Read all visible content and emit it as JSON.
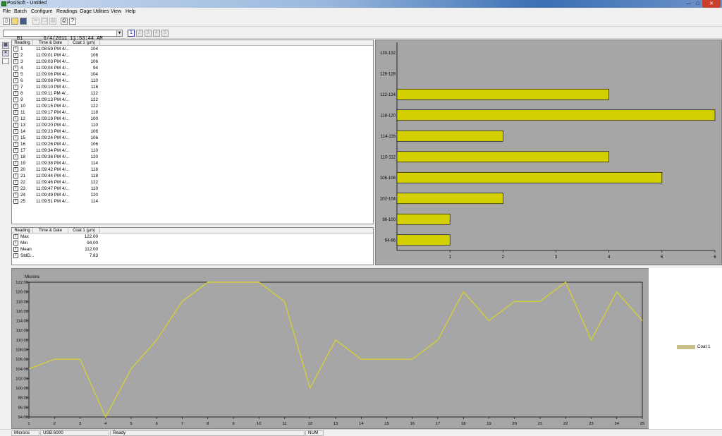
{
  "window": {
    "title": "PosiSoft - Untitled",
    "min_label": "—",
    "max_label": "□",
    "close_label": "✕"
  },
  "menu": [
    "File",
    "Batch",
    "Configure",
    "Readings",
    "Gage Utilities",
    "View",
    "Help"
  ],
  "toolbar": {
    "icons": [
      "new-file-icon",
      "open-folder-icon",
      "save-icon",
      "cut-icon",
      "copy-icon",
      "paste-icon",
      "print-icon",
      "help-icon"
    ]
  },
  "batch": {
    "selected": "B1       6/4/2011 11:53:44 AM",
    "pages": [
      "1",
      "2",
      "3",
      "4",
      "5"
    ],
    "active_page": "1"
  },
  "readings_table": {
    "headers": [
      "Reading",
      "Time & Date",
      "Coat 1  (µm)"
    ],
    "rows": [
      [
        "1",
        "11:08:59 PM 4/...",
        "104"
      ],
      [
        "2",
        "11:09:01 PM 4/...",
        "106"
      ],
      [
        "3",
        "11:09:03 PM 4/...",
        "106"
      ],
      [
        "4",
        "11:09:04 PM 4/...",
        "94"
      ],
      [
        "5",
        "11:09:06 PM 4/...",
        "104"
      ],
      [
        "6",
        "11:09:08 PM 4/...",
        "110"
      ],
      [
        "7",
        "11:09:10 PM 4/...",
        "118"
      ],
      [
        "8",
        "11:09:11 PM 4/...",
        "122"
      ],
      [
        "9",
        "11:09:13 PM 4/...",
        "122"
      ],
      [
        "10",
        "11:09:15 PM 4/...",
        "122"
      ],
      [
        "11",
        "11:09:17 PM 4/...",
        "118"
      ],
      [
        "12",
        "11:09:19 PM 4/...",
        "100"
      ],
      [
        "13",
        "11:09:20 PM 4/...",
        "110"
      ],
      [
        "14",
        "11:09:23 PM 4/...",
        "106"
      ],
      [
        "15",
        "11:09:24 PM 4/...",
        "106"
      ],
      [
        "16",
        "11:09:26 PM 4/...",
        "106"
      ],
      [
        "17",
        "11:09:34 PM 4/...",
        "110"
      ],
      [
        "18",
        "11:09:36 PM 4/...",
        "120"
      ],
      [
        "19",
        "11:09:38 PM 4/...",
        "114"
      ],
      [
        "20",
        "11:09:42 PM 4/...",
        "118"
      ],
      [
        "21",
        "11:09:44 PM 4/...",
        "118"
      ],
      [
        "22",
        "11:09:46 PM 4/...",
        "122"
      ],
      [
        "23",
        "11:09:47 PM 4/...",
        "110"
      ],
      [
        "24",
        "11:09:49 PM 4/...",
        "120"
      ],
      [
        "25",
        "11:09:51 PM 4/...",
        "114"
      ]
    ]
  },
  "stats_table": {
    "headers": [
      "Reading",
      "Time & Date",
      "Coat 1  (µm)"
    ],
    "rows": [
      [
        "Max",
        "",
        "122.00"
      ],
      [
        "Min",
        "",
        "94.00"
      ],
      [
        "Mean",
        "",
        "112.00"
      ],
      [
        "StdD...",
        "",
        "7.83"
      ]
    ]
  },
  "chart_data": [
    {
      "type": "bar",
      "orientation": "horizontal",
      "categories": [
        "94-96",
        "98-100",
        "102-104",
        "106-108",
        "110-112",
        "114-116",
        "118-120",
        "122-124",
        "126-128",
        "130-132"
      ],
      "values": [
        1,
        1,
        2,
        5,
        4,
        2,
        6,
        4,
        0,
        0
      ],
      "xlim": [
        0,
        6
      ],
      "xticks": [
        "1",
        "2",
        "3",
        "4",
        "5",
        "6"
      ],
      "bar_color": "#d4cf00",
      "background": "#a6a6a6"
    },
    {
      "type": "line",
      "ylabel": "Microns",
      "x": [
        1,
        2,
        3,
        4,
        5,
        6,
        7,
        8,
        9,
        10,
        11,
        12,
        13,
        14,
        15,
        16,
        17,
        18,
        19,
        20,
        21,
        22,
        23,
        24,
        25
      ],
      "series": [
        {
          "name": "Coat 1",
          "values": [
            104,
            106,
            106,
            94,
            104,
            110,
            118,
            122,
            122,
            122,
            118,
            100,
            110,
            106,
            106,
            106,
            110,
            120,
            114,
            118,
            118,
            122,
            110,
            120,
            114
          ]
        }
      ],
      "ylim": [
        94,
        122
      ],
      "yticks": [
        "94.00",
        "96.00",
        "98.00",
        "100.00",
        "102.00",
        "104.00",
        "106.00",
        "108.00",
        "110.00",
        "112.00",
        "114.00",
        "116.00",
        "118.00",
        "120.00",
        "122.00"
      ],
      "line_color": "#d4cf3a",
      "background": "#a6a6a6",
      "grid": false,
      "legend": "right"
    }
  ],
  "statusbar": {
    "units": "Microns",
    "gage": "USB:6000",
    "status": "Ready",
    "num": "NUM"
  }
}
